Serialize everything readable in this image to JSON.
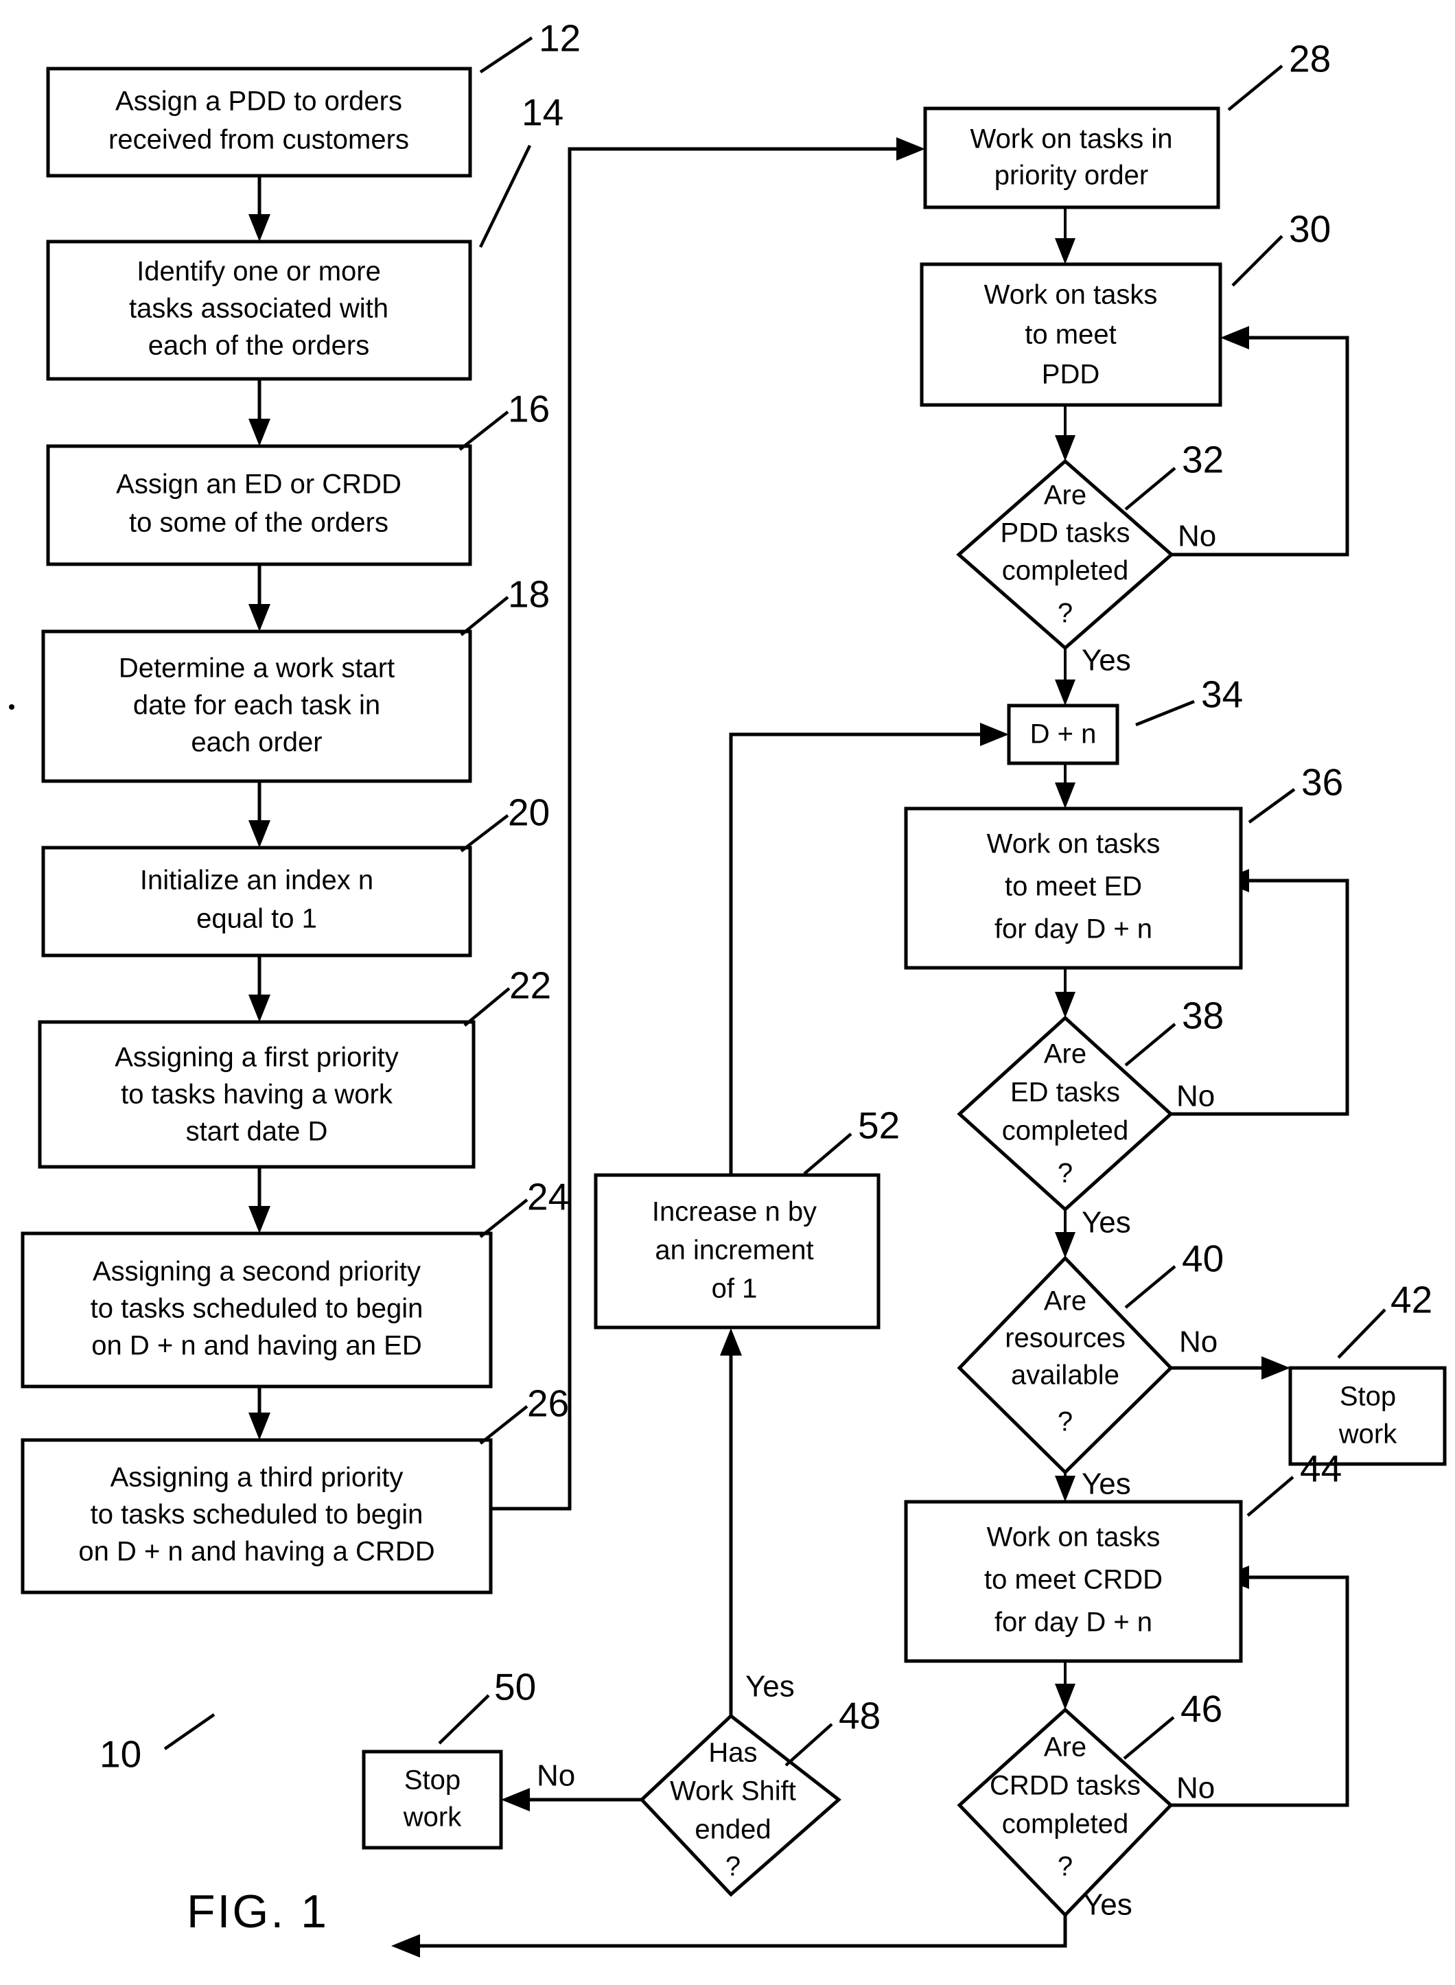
{
  "figure": {
    "label": "FIG. 1",
    "system_ref": "10"
  },
  "nodes": {
    "n12": {
      "ref": "12",
      "type": "process",
      "lines": [
        "Assign a PDD to orders",
        "received from customers"
      ]
    },
    "n14": {
      "ref": "14",
      "type": "process",
      "lines": [
        "Identify one or more",
        "tasks associated with",
        "each of the orders"
      ]
    },
    "n16": {
      "ref": "16",
      "type": "process",
      "lines": [
        "Assign an ED or CRDD",
        "to some of the orders"
      ]
    },
    "n18": {
      "ref": "18",
      "type": "process",
      "lines": [
        "Determine a work start",
        "date for each task in",
        "each order"
      ]
    },
    "n20": {
      "ref": "20",
      "type": "process",
      "lines": [
        "Initialize an index n",
        "equal to 1"
      ]
    },
    "n22": {
      "ref": "22",
      "type": "process",
      "lines": [
        "Assigning a first priority",
        "to tasks having a work",
        "start date D"
      ]
    },
    "n24": {
      "ref": "24",
      "type": "process",
      "lines": [
        "Assigning a second priority",
        "to tasks scheduled to begin",
        "on D + n and having an ED"
      ]
    },
    "n26": {
      "ref": "26",
      "type": "process",
      "lines": [
        "Assigning a third priority",
        "to  tasks scheduled to begin",
        "on D + n and having a CRDD"
      ]
    },
    "n28": {
      "ref": "28",
      "type": "process",
      "lines": [
        "Work on tasks in",
        "priority order"
      ]
    },
    "n30": {
      "ref": "30",
      "type": "process",
      "lines": [
        "Work on tasks",
        "to meet",
        "PDD"
      ]
    },
    "n32": {
      "ref": "32",
      "type": "decision",
      "lines": [
        "Are",
        "PDD tasks",
        "completed",
        "?"
      ]
    },
    "n34": {
      "ref": "34",
      "type": "process",
      "lines": [
        "D + n"
      ]
    },
    "n36": {
      "ref": "36",
      "type": "process",
      "lines": [
        "Work on tasks",
        "to meet ED",
        "for day D + n"
      ]
    },
    "n38": {
      "ref": "38",
      "type": "decision",
      "lines": [
        "Are",
        "ED tasks",
        "completed",
        "?"
      ]
    },
    "n40": {
      "ref": "40",
      "type": "decision",
      "lines": [
        "Are",
        "resources",
        "available",
        "?"
      ]
    },
    "n42": {
      "ref": "42",
      "type": "process",
      "lines": [
        "Stop",
        "work"
      ]
    },
    "n44": {
      "ref": "44",
      "type": "process",
      "lines": [
        "Work on tasks",
        "to meet CRDD",
        "for day D + n"
      ]
    },
    "n46": {
      "ref": "46",
      "type": "decision",
      "lines": [
        "Are",
        "CRDD tasks",
        "completed",
        "?"
      ]
    },
    "n48": {
      "ref": "48",
      "type": "decision",
      "lines": [
        "Has",
        "Work Shift",
        "ended",
        "?"
      ]
    },
    "n50": {
      "ref": "50",
      "type": "process",
      "lines": [
        "Stop",
        "work"
      ]
    },
    "n52": {
      "ref": "52",
      "type": "process",
      "lines": [
        "Increase n by",
        "an increment",
        "of 1"
      ]
    }
  },
  "edge_labels": {
    "e32_no": "No",
    "e32_yes": "Yes",
    "e38_no": "No",
    "e38_yes": "Yes",
    "e40_no": "No",
    "e40_yes": "Yes",
    "e46_no": "No",
    "e46_yes": "Yes",
    "e48_no": "No",
    "e48_yes": "Yes"
  },
  "colors": {
    "stroke": "#000000",
    "fill": "#ffffff",
    "background": "#ffffff"
  }
}
